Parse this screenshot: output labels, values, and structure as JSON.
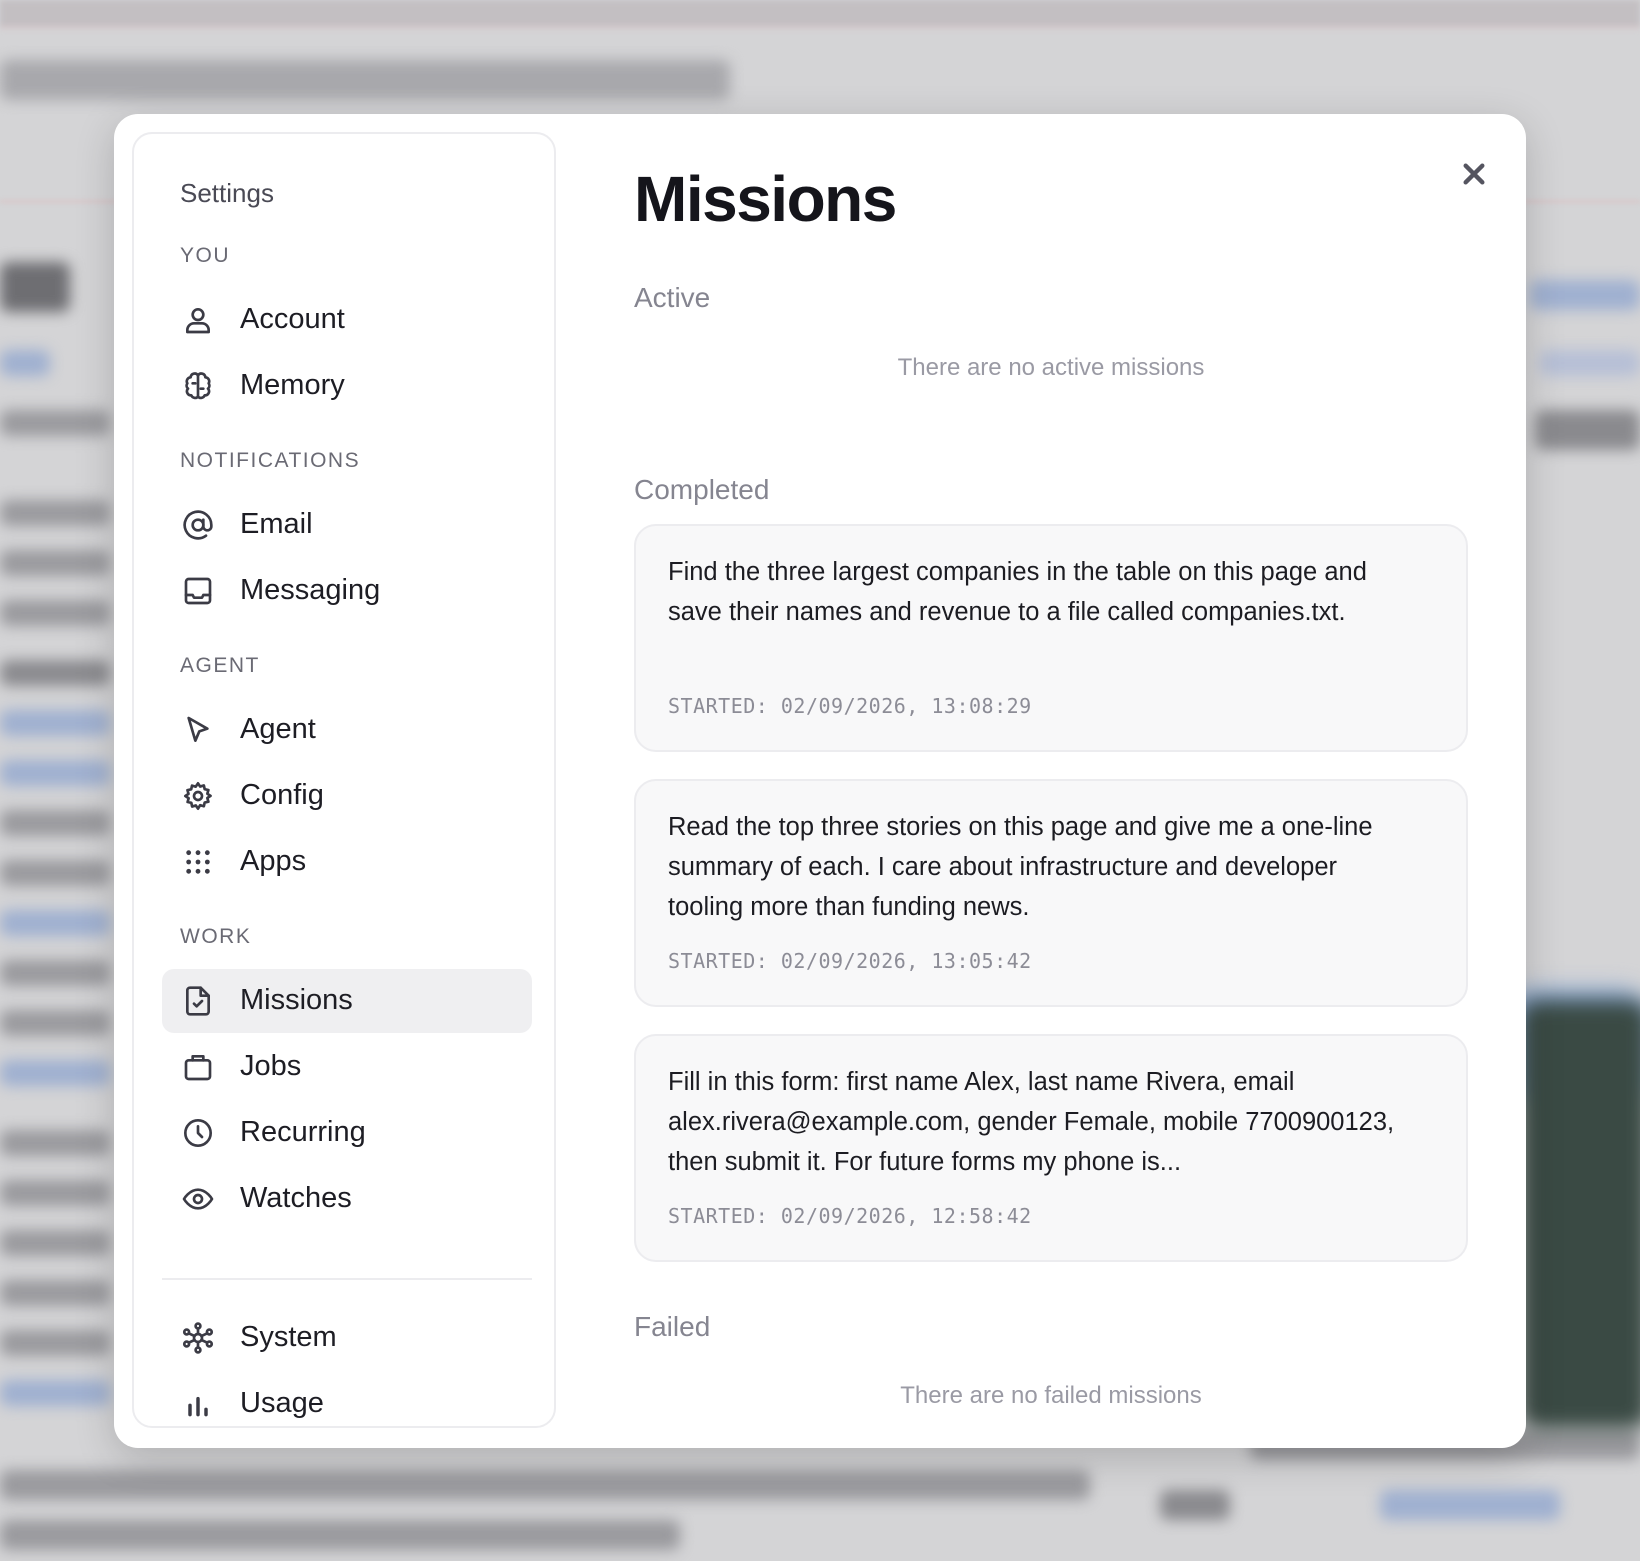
{
  "sidebar": {
    "title": "Settings",
    "sections": {
      "you": "YOU",
      "notifications": "NOTIFICATIONS",
      "agent": "AGENT",
      "work": "WORK"
    },
    "items": {
      "account": {
        "label": "Account",
        "icon": "user-icon"
      },
      "memory": {
        "label": "Memory",
        "icon": "brain-icon"
      },
      "email": {
        "label": "Email",
        "icon": "at-sign-icon"
      },
      "messaging": {
        "label": "Messaging",
        "icon": "inbox-icon"
      },
      "agent": {
        "label": "Agent",
        "icon": "cursor-pointer-icon"
      },
      "config": {
        "label": "Config",
        "icon": "gear-icon"
      },
      "apps": {
        "label": "Apps",
        "icon": "grid-dots-icon"
      },
      "missions": {
        "label": "Missions",
        "icon": "file-check-icon",
        "active": true
      },
      "jobs": {
        "label": "Jobs",
        "icon": "briefcase-icon"
      },
      "recurring": {
        "label": "Recurring",
        "icon": "clock-icon"
      },
      "watches": {
        "label": "Watches",
        "icon": "eye-icon"
      },
      "system": {
        "label": "System",
        "icon": "network-icon"
      },
      "usage": {
        "label": "Usage",
        "icon": "bar-chart-icon"
      }
    }
  },
  "main": {
    "title": "Missions",
    "active": {
      "heading": "Active",
      "empty": "There are no active missions"
    },
    "completed": {
      "heading": "Completed",
      "missions": [
        {
          "text": "Find the three largest companies in the table on this page and save their names and revenue to a file called companies.txt.",
          "started": "STARTED: 02/09/2026, 13:08:29"
        },
        {
          "text": "Read the top three stories on this page and give me a one-line summary of each. I care about infrastructure and developer tooling more than funding news.",
          "started": "STARTED: 02/09/2026, 13:05:42"
        },
        {
          "text": "Fill in this form: first name Alex, last name Rivera, email alex.rivera@example.com, gender Female, mobile 7700900123, then submit it. For future forms my phone is...",
          "started": "STARTED: 02/09/2026, 12:58:42"
        }
      ]
    },
    "failed": {
      "heading": "Failed",
      "empty": "There are no failed missions"
    }
  },
  "colors": {
    "active_item_bg": "#efeff1",
    "card_bg": "#f8f8f9",
    "muted_text": "#9a9aa4"
  }
}
